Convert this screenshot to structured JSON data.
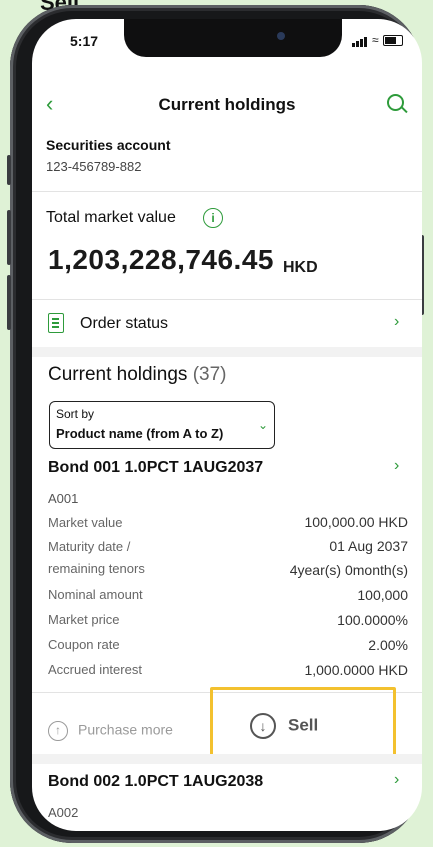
{
  "top_cut": "Sell",
  "status": {
    "time": "5:17"
  },
  "nav": {
    "title": "Current holdings"
  },
  "account": {
    "label": "Securities account",
    "number": "123-456789-882"
  },
  "market_value": {
    "label": "Total market value",
    "amount": "1,203,228,746.45",
    "currency": "HKD"
  },
  "order_status": {
    "label": "Order status"
  },
  "holdings": {
    "title": "Current holdings",
    "count": "(37)",
    "sort": {
      "label": "Sort by",
      "value": "Product name (from A to Z)"
    },
    "items": [
      {
        "name": "Bond 001 1.0PCT 1AUG2037",
        "code": "A001",
        "details": [
          {
            "label": "Market value",
            "value": "100,000.00 HKD"
          },
          {
            "label": "Maturity date /",
            "value": "01 Aug 2037"
          },
          {
            "label": "remaining tenors",
            "value": "4year(s) 0month(s)"
          },
          {
            "label": "Nominal amount",
            "value": "100,000"
          },
          {
            "label": "Market price",
            "value": "100.0000%"
          },
          {
            "label": "Coupon rate",
            "value": "2.00%"
          },
          {
            "label": "Accrued interest",
            "value": "1,000.0000 HKD"
          }
        ],
        "actions": {
          "purchase": "Purchase more",
          "sell": "Sell"
        }
      },
      {
        "name": "Bond 002 1.0PCT 1AUG2038",
        "code": "A002"
      }
    ]
  },
  "colors": {
    "accent": "#2e9b3b",
    "highlight": "#f3c12e"
  }
}
